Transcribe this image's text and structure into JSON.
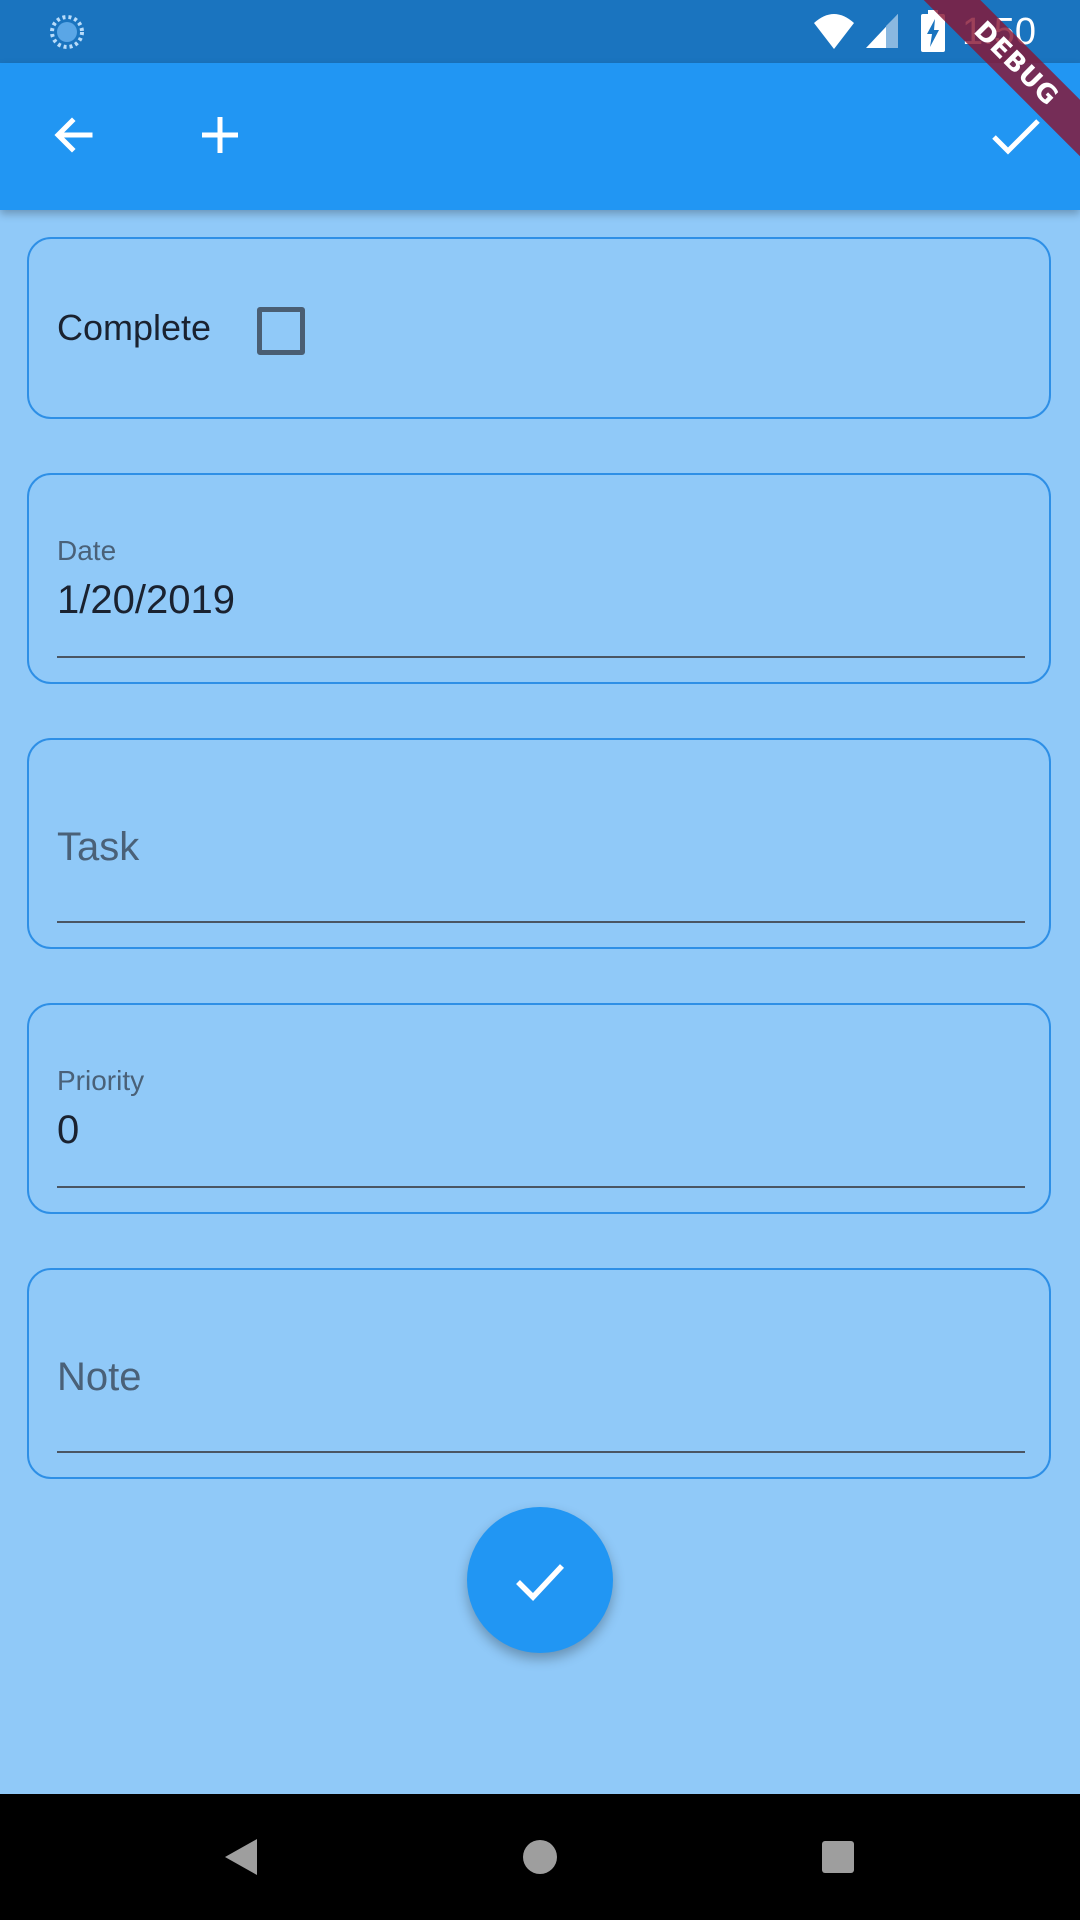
{
  "status_bar": {
    "time": "1:50",
    "icons": [
      "loading-spinner-icon",
      "wifi-icon",
      "cell-signal-icon",
      "battery-charging-icon"
    ]
  },
  "app_bar": {
    "icons": {
      "back": "arrow-back-icon",
      "add": "add-icon",
      "done": "check-icon"
    },
    "color": "#2196f3"
  },
  "debug_banner": {
    "label": "DEBUG"
  },
  "form": {
    "complete": {
      "label": "Complete",
      "checked": false
    },
    "date": {
      "label": "Date",
      "value": "1/20/2019"
    },
    "task": {
      "placeholder": "Task",
      "value": ""
    },
    "priority": {
      "label": "Priority",
      "value": "0"
    },
    "note": {
      "placeholder": "Note",
      "value": ""
    }
  },
  "fab": {
    "icon": "check-icon"
  },
  "nav_bar": {
    "icons": [
      "nav-back-icon",
      "nav-home-icon",
      "nav-recents-icon"
    ]
  },
  "colors": {
    "status_bar": "#1a74bf",
    "primary": "#2196f3",
    "background": "#90c9f8",
    "card_border": "#2e8fe6"
  }
}
